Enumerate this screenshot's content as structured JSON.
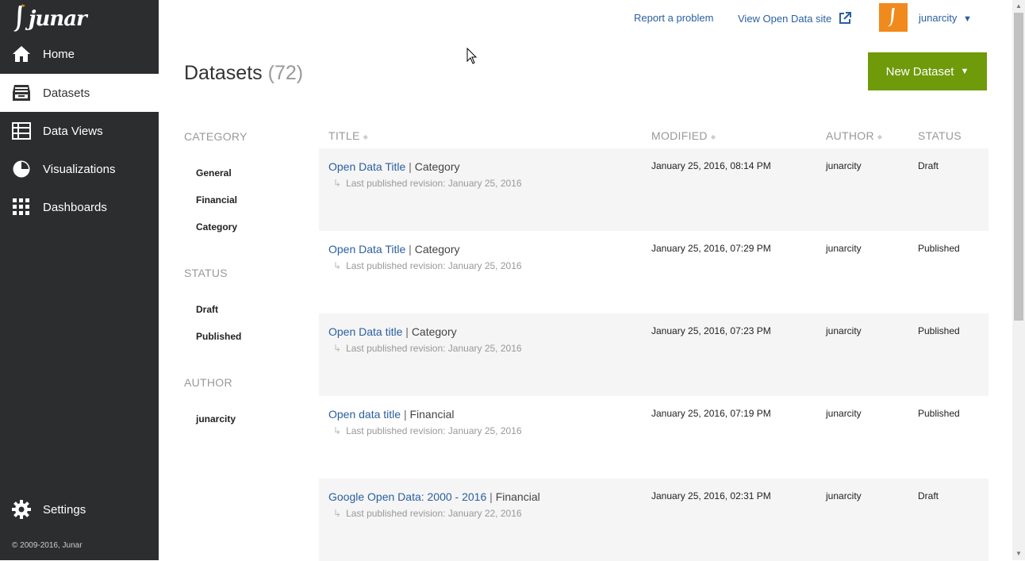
{
  "app": {
    "logo": "junar",
    "copyright": "© 2009-2016, Junar"
  },
  "sidebar": {
    "items": [
      {
        "label": "Home",
        "icon": "home-icon"
      },
      {
        "label": "Datasets",
        "icon": "datasets-icon",
        "active": true
      },
      {
        "label": "Data Views",
        "icon": "table-icon"
      },
      {
        "label": "Visualizations",
        "icon": "pie-chart-icon"
      },
      {
        "label": "Dashboards",
        "icon": "grid-icon"
      }
    ],
    "settings": {
      "label": "Settings",
      "icon": "gear-icon"
    }
  },
  "topbar": {
    "report": "Report a problem",
    "view_site": "View Open Data site",
    "user": "junarcity",
    "user_caret": "▼"
  },
  "page": {
    "title": "Datasets",
    "count": "(72)",
    "new_button": "New Dataset",
    "new_button_caret": "▼"
  },
  "filters": {
    "category": {
      "heading": "CATEGORY",
      "items": [
        "General",
        "Financial",
        "Category"
      ]
    },
    "status": {
      "heading": "STATUS",
      "items": [
        "Draft",
        "Published"
      ]
    },
    "author": {
      "heading": "AUTHOR",
      "items": [
        "junarcity"
      ]
    }
  },
  "table": {
    "columns": [
      "TITLE",
      "MODIFIED",
      "AUTHOR",
      "STATUS"
    ],
    "rows": [
      {
        "title": "Open Data Title",
        "category": "Category",
        "revision": "Last published revision: January 25, 2016",
        "modified": "January 25, 2016, 08:14 PM",
        "author": "junarcity",
        "status": "Draft"
      },
      {
        "title": "Open Data Title",
        "category": "Category",
        "revision": "Last published revision: January 25, 2016",
        "modified": "January 25, 2016, 07:29 PM",
        "author": "junarcity",
        "status": "Published"
      },
      {
        "title": "Open Data title",
        "category": "Category",
        "revision": "Last published revision: January 25, 2016",
        "modified": "January 25, 2016, 07:23 PM",
        "author": "junarcity",
        "status": "Published"
      },
      {
        "title": "Open data title",
        "category": "Financial",
        "revision": "Last published revision: January 25, 2016",
        "modified": "January 25, 2016, 07:19 PM",
        "author": "junarcity",
        "status": "Published"
      },
      {
        "title": "Google Open Data: 2000 - 2016",
        "category": "Financial",
        "revision": "Last published revision: January 22, 2016",
        "modified": "January 25, 2016, 02:31 PM",
        "author": "junarcity",
        "status": "Draft"
      }
    ]
  },
  "colors": {
    "sidebar": "#2c2d2f",
    "accent_button": "#6f9a0a",
    "link": "#2a5fa0",
    "avatar": "#f08a1c"
  }
}
